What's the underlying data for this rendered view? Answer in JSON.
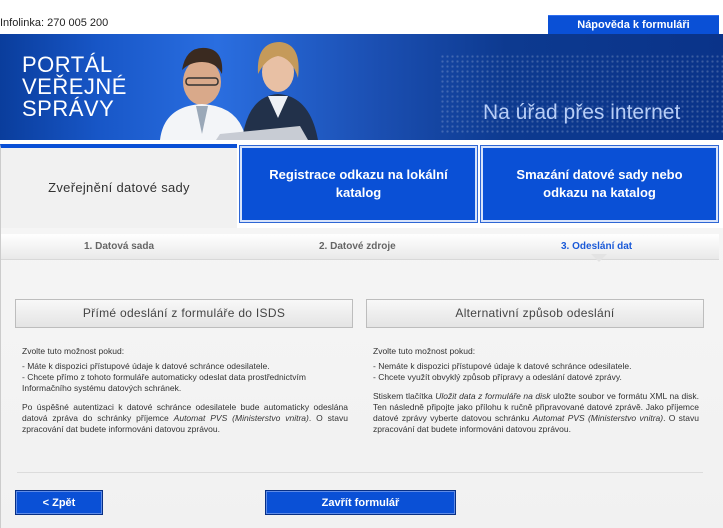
{
  "topbar": {
    "infolinka": "Infolinka: 270 005 200",
    "help_label": "Nápověda k formuláři"
  },
  "banner": {
    "logo_line1": "PORTÁL",
    "logo_line2": "VEŘEJNÉ",
    "logo_line3": "SPRÁVY",
    "tagline": "Na úřad přes internet"
  },
  "tabs": [
    {
      "label": "Zveřejnění datové sady",
      "active": true
    },
    {
      "label": "Registrace odkazu na lokální katalog",
      "active": false
    },
    {
      "label": "Smazání datové sady nebo odkazu na katalog",
      "active": false
    }
  ],
  "steps": [
    {
      "label": "1. Datová sada",
      "active": false
    },
    {
      "label": "2. Datové zdroje",
      "active": false
    },
    {
      "label": "3. Odeslání dat",
      "active": true
    }
  ],
  "options": {
    "left": {
      "button": "Přímé odeslání z formuláře do ISDS",
      "intro": "Zvolte tuto možnost pokud:",
      "bullet1": "- Máte k dispozici přístupové údaje k datové schránce odesilatele.",
      "bullet2": "- Chcete přímo z tohoto formuláře automaticky odeslat data prostřednictvím Informačního systému datových schránek.",
      "para_a": "Po úspěšné autentizaci k datové schránce odesilatele bude automaticky odeslána datová zpráva do schránky příjemce ",
      "para_em": "Automat PVS (Ministerstvo vnitra)",
      "para_b": ". O stavu zpracování dat budete informováni datovou zprávou."
    },
    "right": {
      "button": "Alternativní způsob odeslání",
      "intro": "Zvolte tuto možnost pokud:",
      "bullet1": "- Nemáte k dispozici přístupové údaje k datové schránce odesilatele.",
      "bullet2": "- Chcete využít obvyklý způsob přípravy a odeslání datové zprávy.",
      "para_a": "Stiskem tlačítka ",
      "para_em1": "Uložit data z formuláře na disk",
      "para_b": " uložte soubor ve formátu XML na disk. Ten následně připojte jako přílohu k ručně připravované datové zprávě. Jako příjemce datové zprávy vyberte datovou schránku ",
      "para_em2": "Automat PVS (Ministerstvo vnitra)",
      "para_c": ". O stavu zpracování dat budete informováni datovou zprávou."
    }
  },
  "buttons": {
    "back": "< Zpět",
    "close": "Zavřít formulář"
  },
  "colors": {
    "accent": "#0a50d6",
    "active_step": "#1a5ad8"
  }
}
